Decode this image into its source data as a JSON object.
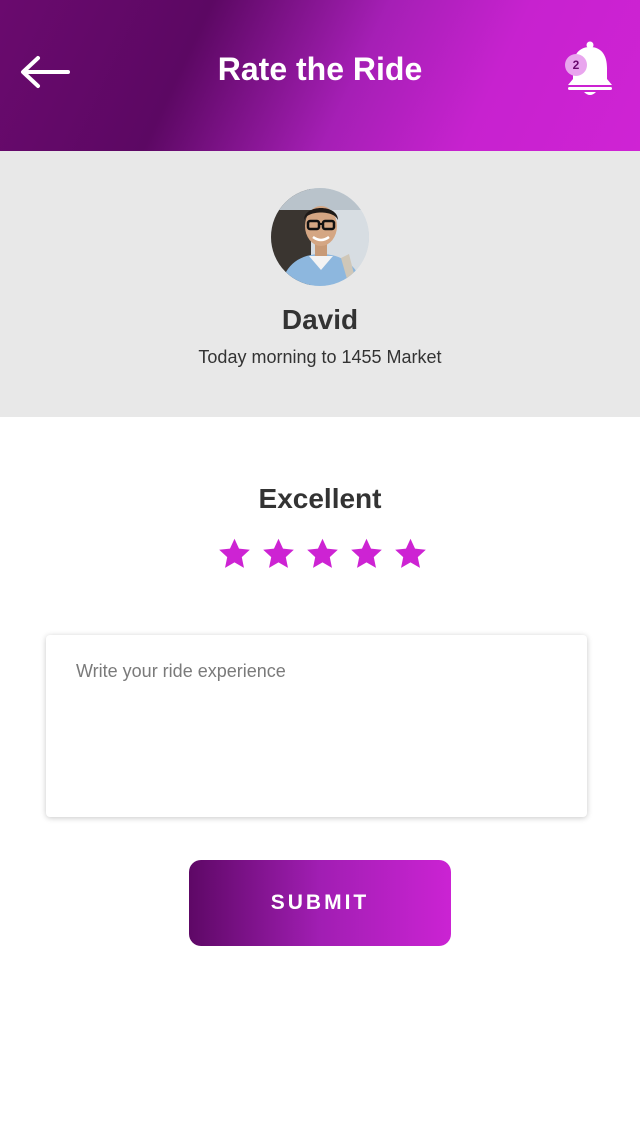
{
  "header": {
    "title": "Rate the Ride",
    "back_icon": "arrow-left-icon",
    "notification_icon": "bell-icon",
    "notification_count": "2"
  },
  "driver": {
    "name": "David",
    "trip": "Today morning to 1455 Market",
    "avatar_icon": "driver-photo"
  },
  "rating": {
    "label": "Excellent",
    "value": 5,
    "max": 5,
    "star_color": "#cd23d3"
  },
  "review": {
    "placeholder": "Write your ride experience",
    "value": ""
  },
  "submit": {
    "label": "SUBMIT"
  },
  "colors": {
    "brand_dark": "#5e0866",
    "brand_light": "#cf23d4",
    "driver_bg": "#e8e8e8"
  }
}
